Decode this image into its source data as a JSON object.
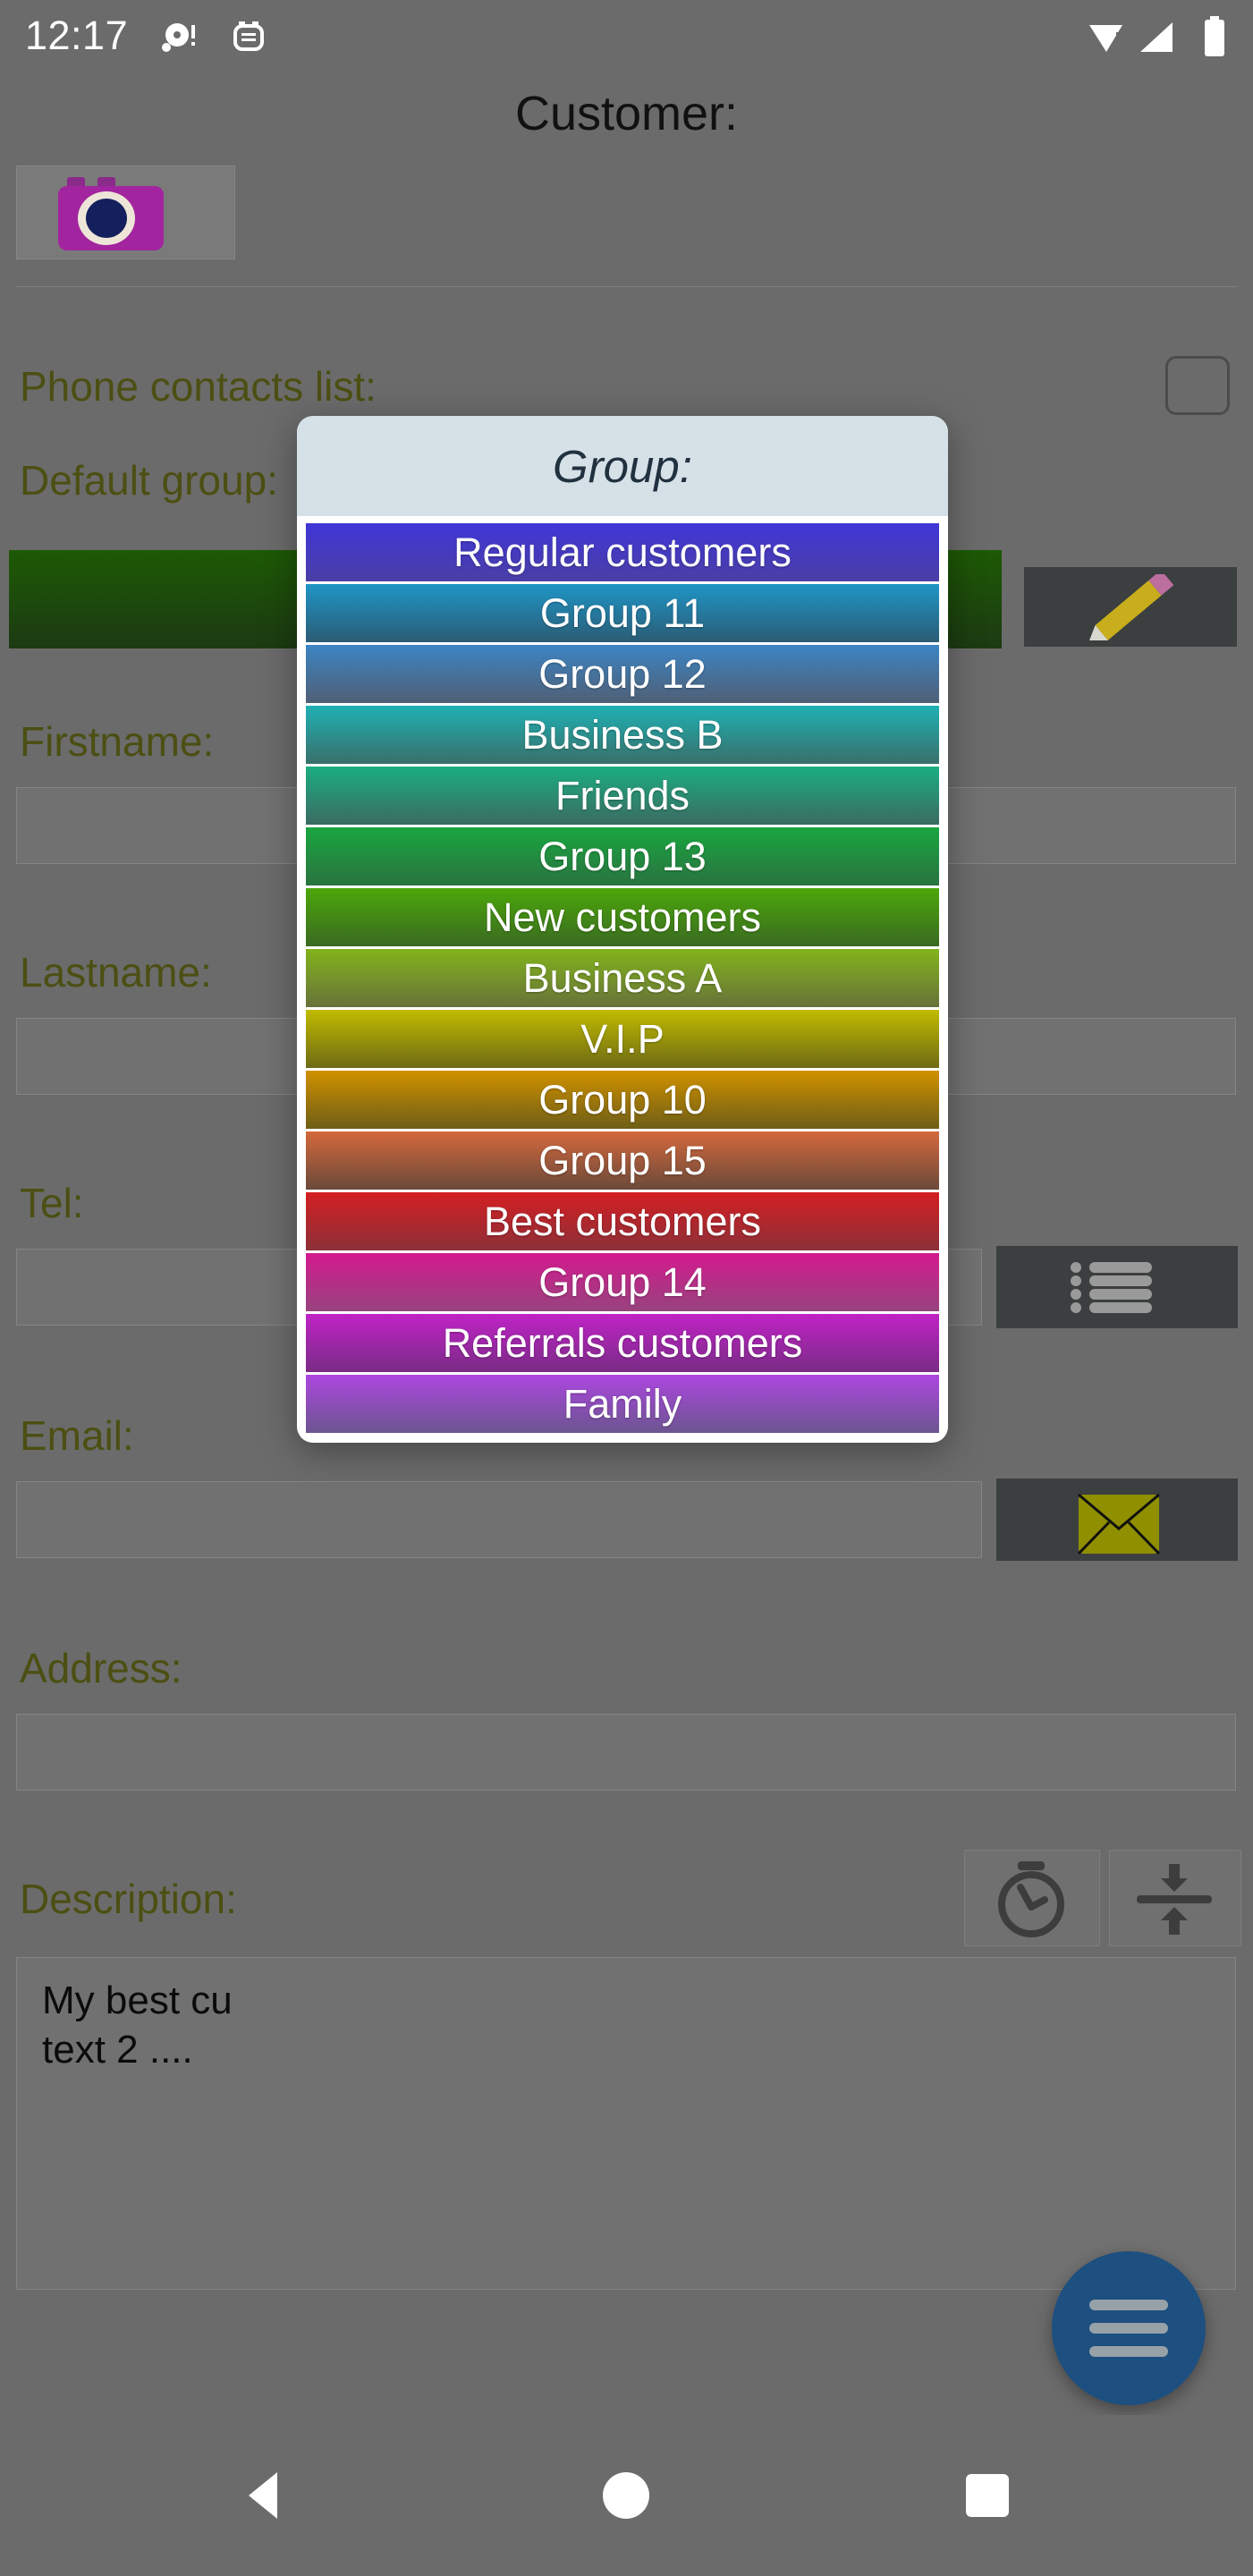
{
  "status_bar": {
    "time": "12:17",
    "icons": [
      "record-dot-icon",
      "alarm-icon",
      "wifi-icon",
      "signal-icon",
      "battery-icon"
    ]
  },
  "page": {
    "title": "Customer:"
  },
  "form": {
    "photo_label": "camera-icon",
    "contacts_label": "Phone contacts list:",
    "contacts_checked": false,
    "default_group_label": "Default group:",
    "default_group_value": "",
    "firstname_label": "Firstname:",
    "firstname_value": "",
    "lastname_label": "Lastname:",
    "lastname_value": "",
    "tel_label": "Tel:",
    "tel_value": "",
    "email_label": "Email:",
    "email_value": "",
    "address_label": "Address:",
    "address_value": "",
    "description_label": "Description:",
    "description_value": "My best cu\ntext 2 ...."
  },
  "dialog": {
    "title": "Group:",
    "header_bg": "#d5e1e7",
    "title_color": "#22313f",
    "items": [
      {
        "label": "Regular customers",
        "top": "#4036d8",
        "bottom": "#4a3fa5"
      },
      {
        "label": "Group 11",
        "top": "#1f95c6",
        "bottom": "#2b5c75"
      },
      {
        "label": "Group 12",
        "top": "#3c85c4",
        "bottom": "#4f5f75"
      },
      {
        "label": "Business B",
        "top": "#1fb0b4",
        "bottom": "#39706a"
      },
      {
        "label": "Friends",
        "top": "#1bae81",
        "bottom": "#3b6a62"
      },
      {
        "label": "Group 13",
        "top": "#19a63f",
        "bottom": "#2a7340"
      },
      {
        "label": "New customers",
        "top": "#4ca70a",
        "bottom": "#3a6a22"
      },
      {
        "label": "Business A",
        "top": "#82b41b",
        "bottom": "#67723a"
      },
      {
        "label": "V.I.P",
        "top": "#c0bb00",
        "bottom": "#6e6a14"
      },
      {
        "label": "Group 10",
        "top": "#d19100",
        "bottom": "#6e5e16"
      },
      {
        "label": "Group 15",
        "top": "#d4683c",
        "bottom": "#6b4a3a"
      },
      {
        "label": "Best customers",
        "top": "#d41f22",
        "bottom": "#8c3038"
      },
      {
        "label": "Group 14",
        "top": "#d41a8e",
        "bottom": "#97437e"
      },
      {
        "label": "Referrals customers",
        "top": "#c023c6",
        "bottom": "#7a2b86"
      },
      {
        "label": "Family",
        "top": "#ad46e0",
        "bottom": "#6c5590"
      }
    ]
  },
  "buttons": {
    "edit": "pencil-icon",
    "list": "list-icon",
    "mail": "mail-icon",
    "timer": "timer-icon",
    "collapse": "collapse-icon",
    "fab": "menu-icon"
  },
  "navbar": {
    "back": "back-triangle-icon",
    "home": "home-circle-icon",
    "recent": "recent-square-icon"
  },
  "colors": {
    "screen_bg": "#6b6b6b",
    "label_olive": "#4b4f12",
    "fab_blue": "#1d4f80",
    "default_group_green_top": "#1d5a05",
    "default_group_green_bottom": "#1c3a12"
  }
}
